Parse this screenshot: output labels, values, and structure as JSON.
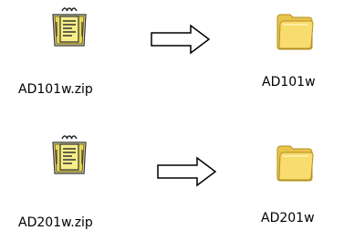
{
  "rows": [
    {
      "zip": {
        "name": "AD101w.zip",
        "icon": "zip-archive-icon"
      },
      "arrow": {
        "icon": "right-arrow-icon"
      },
      "folder": {
        "name": "AD101w",
        "icon": "folder-icon"
      }
    },
    {
      "zip": {
        "name": "AD201w.zip",
        "icon": "zip-archive-icon"
      },
      "arrow": {
        "icon": "right-arrow-icon"
      },
      "folder": {
        "name": "AD201w",
        "icon": "folder-icon"
      }
    }
  ],
  "colors": {
    "folder_fill": "#F6D96A",
    "folder_dark": "#C9A227",
    "zip_binder": "#F2E36A",
    "arrow_stroke": "#000000"
  }
}
